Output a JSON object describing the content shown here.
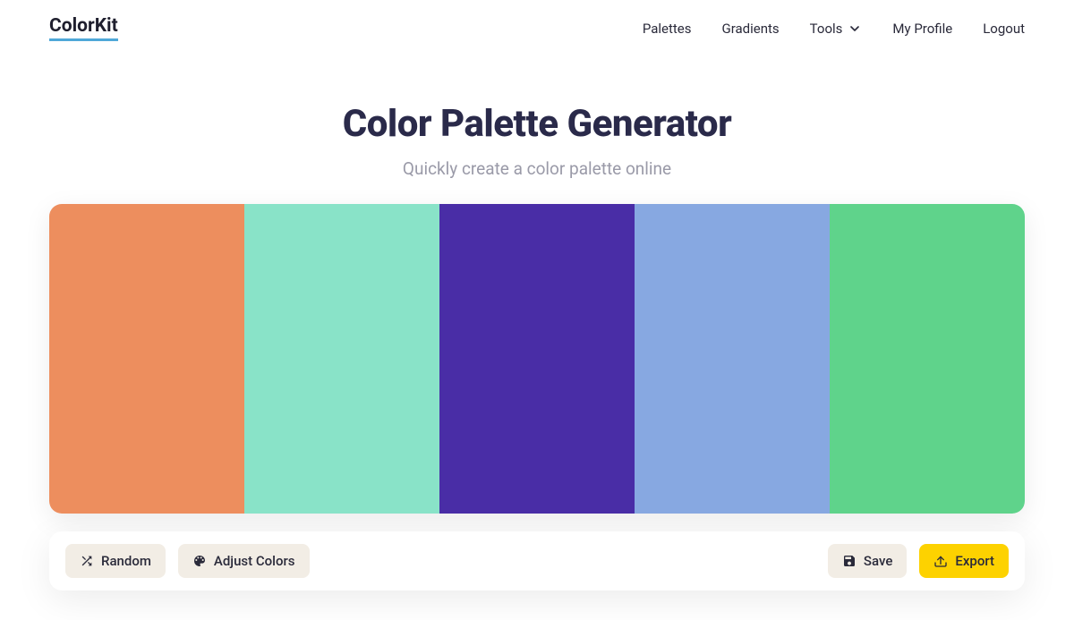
{
  "brand": "ColorKit",
  "nav": {
    "palettes": "Palettes",
    "gradients": "Gradients",
    "tools": "Tools",
    "profile": "My Profile",
    "logout": "Logout"
  },
  "page": {
    "title": "Color Palette Generator",
    "subtitle": "Quickly create a color palette online"
  },
  "palette": {
    "colors": [
      "#ed8e5e",
      "#89e3c8",
      "#492da6",
      "#87a8e1",
      "#5fd38b"
    ]
  },
  "toolbar": {
    "random": "Random",
    "adjust": "Adjust Colors",
    "save": "Save",
    "export": "Export"
  }
}
